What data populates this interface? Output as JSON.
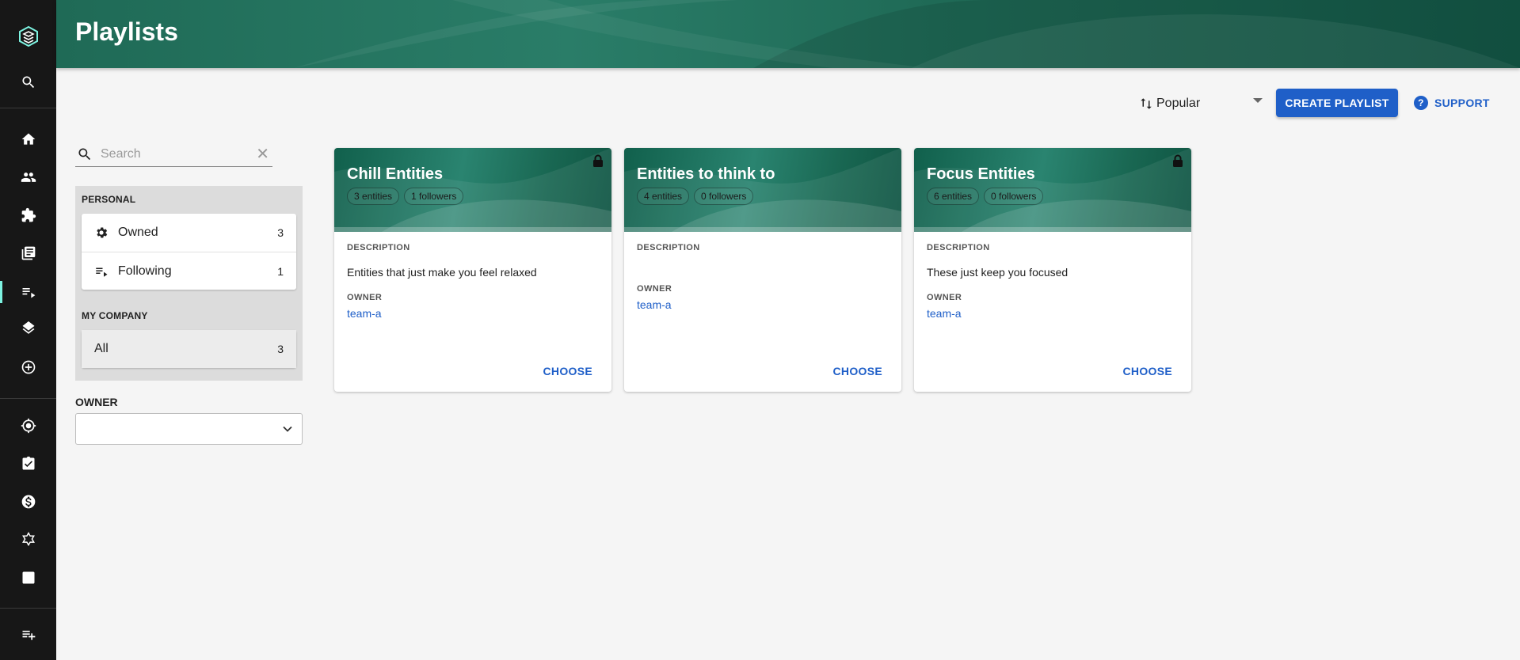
{
  "header": {
    "title": "Playlists"
  },
  "sidebar": {
    "icons": [
      "logo-icon",
      "search-icon",
      "home-icon",
      "people-icon",
      "puzzle-icon",
      "library-icon",
      "playlist-icon",
      "layers-icon",
      "add-circle-icon",
      "target-icon",
      "clipboard-icon",
      "dollar-icon",
      "graph-icon",
      "score-icon",
      "playlist-add-icon"
    ],
    "active": "playlist-icon"
  },
  "toolbar": {
    "sort_value": "Popular",
    "create_label": "CREATE PLAYLIST",
    "support_label": "SUPPORT"
  },
  "search": {
    "placeholder": "Search",
    "value": ""
  },
  "filters": {
    "personal_label": "PERSONAL",
    "personal": [
      {
        "label": "Owned",
        "count": "3",
        "icon": "gear-icon"
      },
      {
        "label": "Following",
        "count": "1",
        "icon": "playlist-icon"
      }
    ],
    "company_label": "MY COMPANY",
    "company": [
      {
        "label": "All",
        "count": "3"
      }
    ],
    "owner_label": "OWNER",
    "owner_value": ""
  },
  "cards": [
    {
      "title": "Chill Entities",
      "entities": "3 entities",
      "followers": "1 followers",
      "locked": true,
      "description_label": "DESCRIPTION",
      "description": "Entities that just make you feel relaxed",
      "owner_label": "OWNER",
      "owner": "team-a",
      "action": "CHOOSE"
    },
    {
      "title": "Entities to think to",
      "entities": "4 entities",
      "followers": "0 followers",
      "locked": false,
      "description_label": "DESCRIPTION",
      "description": "",
      "owner_label": "OWNER",
      "owner": "team-a",
      "action": "CHOOSE"
    },
    {
      "title": "Focus Entities",
      "entities": "6 entities",
      "followers": "0 followers",
      "locked": true,
      "description_label": "DESCRIPTION",
      "description": "These just keep you focused",
      "owner_label": "OWNER",
      "owner": "team-a",
      "action": "CHOOSE"
    }
  ],
  "colors": {
    "primary": "#1f5fc8",
    "header": "#1f6a56",
    "sidebar": "#171717",
    "active_indicator": "#7df3e1"
  }
}
